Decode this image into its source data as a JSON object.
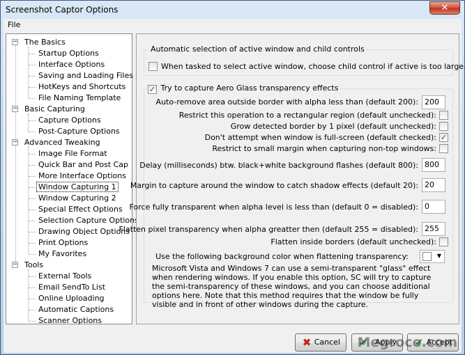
{
  "window": {
    "title": "Screenshot Captor Options",
    "close_glyph": "✕"
  },
  "menu": {
    "file": "File"
  },
  "tree": {
    "groups": [
      {
        "label": "The Basics",
        "items": [
          "Startup Options",
          "Interface Options",
          "Saving and Loading Files",
          "HotKeys and Shortcuts",
          "File Naming Template"
        ]
      },
      {
        "label": "Basic Capturing",
        "items": [
          "Capture Options",
          "Post-Capture Options"
        ]
      },
      {
        "label": "Advanced Tweaking",
        "items": [
          "Image File Format",
          "Quick Bar and Post Cap",
          "More Interface Options",
          "Window Capturing 1",
          "Window Capturing 2",
          "Special Effect Options",
          "Selection Capture Options",
          "Drawing Object Options",
          "Print Options",
          "My Favorites"
        ]
      },
      {
        "label": "Tools",
        "items": [
          "External Tools",
          "Email SendTo List",
          "Online Uploading",
          "Automatic Captions",
          "Scanner Options"
        ]
      }
    ],
    "selected": "Window Capturing 1"
  },
  "panel": {
    "group1": {
      "title": "Automatic selection of active window and child controls",
      "child_control_label": "When tasked to select active window, choose child control if active is too large.",
      "child_control_checked": false
    },
    "group2": {
      "title": "Try to capture Aero Glass transparency effects",
      "aero_checked": true,
      "alpha_label": "Auto-remove area outside border with alpha less than (default 200):",
      "alpha_value": "200",
      "restrict_rect_label": "Restrict this operation to a rectangular region (default unchecked):",
      "restrict_rect_checked": false,
      "grow_border_label": "Grow detected border by 1 pixel (default unchecked):",
      "grow_border_checked": false,
      "fullscreen_label": "Don't attempt when window is full-screen (default checked):",
      "fullscreen_checked": true,
      "small_margin_label": "Restrict to small margin when capturing non-top windows:",
      "small_margin_checked": false,
      "delay_label": "Delay (milliseconds) btw. black+white background flashes (default 800):",
      "delay_value": "800",
      "margin_label": "Margin to capture around the window to catch shadow effects (default 20):",
      "margin_value": "20",
      "force_label": "Force fully transparent when alpha level is less than (default 0 = disabled):",
      "force_value": "0",
      "flatten_label": "Flatten pixel transparency when alpha greatter then (default 255 = disabled):",
      "flatten_value": "255",
      "flatten_inside_label": "Flatten inside borders (default unchecked):",
      "flatten_inside_checked": false,
      "bgcolor_label": "Use the following background color when flattening transparency:",
      "bgcolor": "#ffffff",
      "description": "Microsoft Vista and Windows 7 can use a semi-transparent \"glass\" effect when rendering windows.  If you enable this option, SC will try to capture the semi-transparency of these windows, and you can choose additional options here.  Note that this method requires that the window be fully visible and in front of other windows during the capture."
    }
  },
  "buttons": {
    "cancel": "Cancel",
    "apply": "Apply",
    "accept": "Accept"
  },
  "watermark": "Megroco.com",
  "colors": {
    "accent": "#2a4a8a",
    "cancel_icon": "#c0231d",
    "accept_icon": "#1f8a2e"
  }
}
